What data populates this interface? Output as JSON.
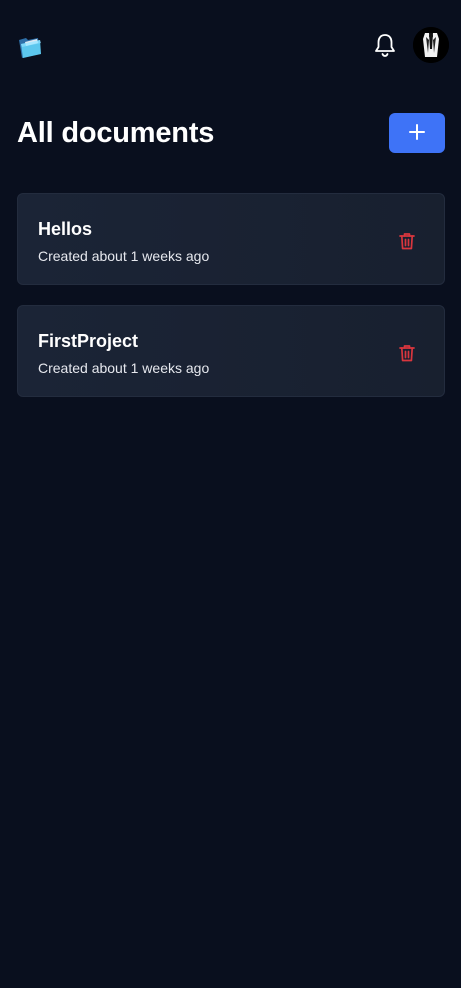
{
  "header": {
    "logo_icon": "folder-logo-icon",
    "notifications_icon": "bell-icon",
    "avatar_icon": "avatar"
  },
  "main": {
    "title": "All documents",
    "add_icon": "plus-icon",
    "documents": [
      {
        "name": "Hellos",
        "meta": "Created about 1 weeks ago",
        "delete_icon": "trash-icon"
      },
      {
        "name": "FirstProject",
        "meta": "Created about 1 weeks ago",
        "delete_icon": "trash-icon"
      }
    ]
  },
  "colors": {
    "background": "#090f1e",
    "card": "#1b2436",
    "accent": "#3e73f7",
    "danger": "#d9363e"
  }
}
